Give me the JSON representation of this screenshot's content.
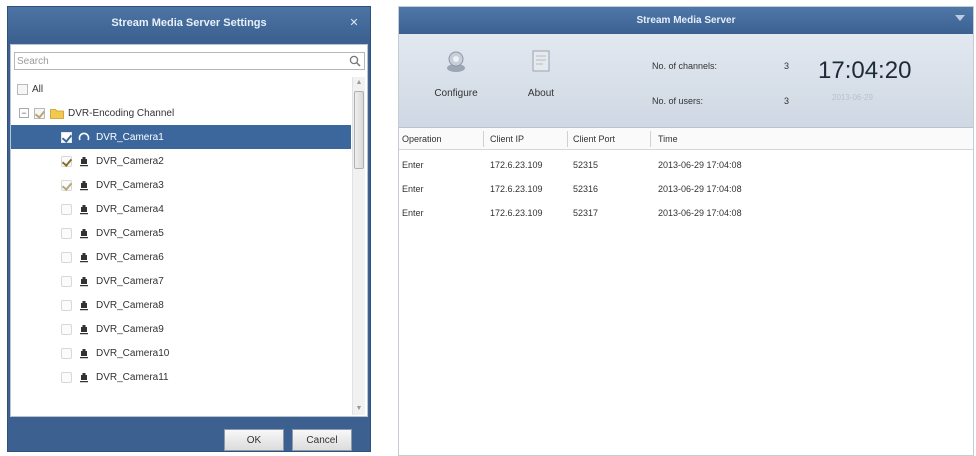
{
  "dialog": {
    "title": "Stream Media Server Settings",
    "search_placeholder": "Search",
    "all_label": "All",
    "group_label": "DVR-Encoding Channel",
    "cameras": [
      {
        "label": "DVR_Camera1",
        "checked": true,
        "selected": true
      },
      {
        "label": "DVR_Camera2",
        "checked": true,
        "selected": false
      },
      {
        "label": "DVR_Camera3",
        "checked": true,
        "selected": false
      },
      {
        "label": "DVR_Camera4",
        "checked": false,
        "selected": false
      },
      {
        "label": "DVR_Camera5",
        "checked": false,
        "selected": false
      },
      {
        "label": "DVR_Camera6",
        "checked": false,
        "selected": false
      },
      {
        "label": "DVR_Camera7",
        "checked": false,
        "selected": false
      },
      {
        "label": "DVR_Camera8",
        "checked": false,
        "selected": false
      },
      {
        "label": "DVR_Camera9",
        "checked": false,
        "selected": false
      },
      {
        "label": "DVR_Camera10",
        "checked": false,
        "selected": false
      },
      {
        "label": "DVR_Camera11",
        "checked": false,
        "selected": false
      }
    ],
    "ok_label": "OK",
    "cancel_label": "Cancel"
  },
  "server": {
    "title": "Stream Media Server",
    "configure_label": "Configure",
    "about_label": "About",
    "channels_label": "No. of channels:",
    "channels_value": "3",
    "users_label": "No. of users:",
    "users_value": "3",
    "clock": "17:04:20",
    "clock_date": "2013-06-29",
    "columns": [
      "Operation",
      "Client IP",
      "Client Port",
      "Time"
    ],
    "rows": [
      [
        "Enter",
        "172.6.23.109",
        "52315",
        "2013-06-29 17:04:08"
      ],
      [
        "Enter",
        "172.6.23.109",
        "52316",
        "2013-06-29 17:04:08"
      ],
      [
        "Enter",
        "172.6.23.109",
        "52317",
        "2013-06-29 17:04:08"
      ]
    ]
  },
  "colors": {
    "title_bar": "#3b6291",
    "selection": "#3b679d"
  }
}
